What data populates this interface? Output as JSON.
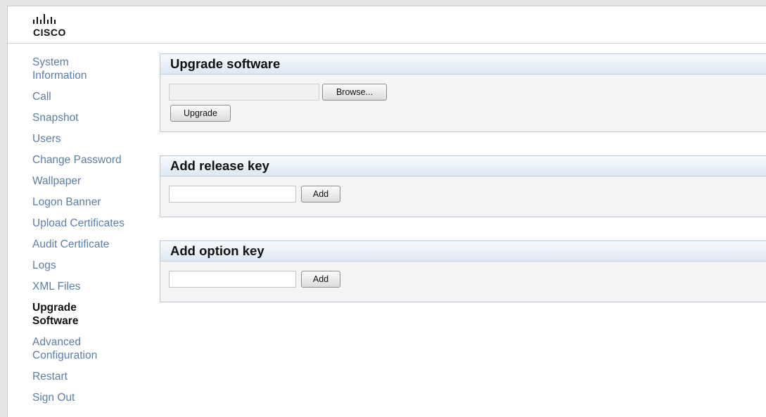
{
  "brand": {
    "logo_text": "CISCO"
  },
  "nav": {
    "items": [
      {
        "label": "System Information"
      },
      {
        "label": "Call"
      },
      {
        "label": "Snapshot"
      },
      {
        "label": "Users"
      },
      {
        "label": "Change Password"
      },
      {
        "label": "Wallpaper"
      },
      {
        "label": "Logon Banner"
      },
      {
        "label": "Upload Certificates"
      },
      {
        "label": "Audit Certificate"
      },
      {
        "label": "Logs"
      },
      {
        "label": "XML Files"
      },
      {
        "label": "Upgrade Software",
        "active": true
      },
      {
        "label": "Advanced Configuration"
      },
      {
        "label": "Restart"
      },
      {
        "label": "Sign Out"
      }
    ]
  },
  "upgrade": {
    "title": "Upgrade software",
    "file_value": "",
    "browse_label": "Browse...",
    "upgrade_label": "Upgrade"
  },
  "release_key": {
    "title": "Add release key",
    "value": "",
    "add_label": "Add"
  },
  "option_key": {
    "title": "Add option key",
    "value": "",
    "add_label": "Add"
  },
  "colors": {
    "nav_link": "#5b7ea8",
    "nav_active": "#111111",
    "panel_border": "#b9c7d6",
    "panel_header_bg": "#dde8f3"
  }
}
